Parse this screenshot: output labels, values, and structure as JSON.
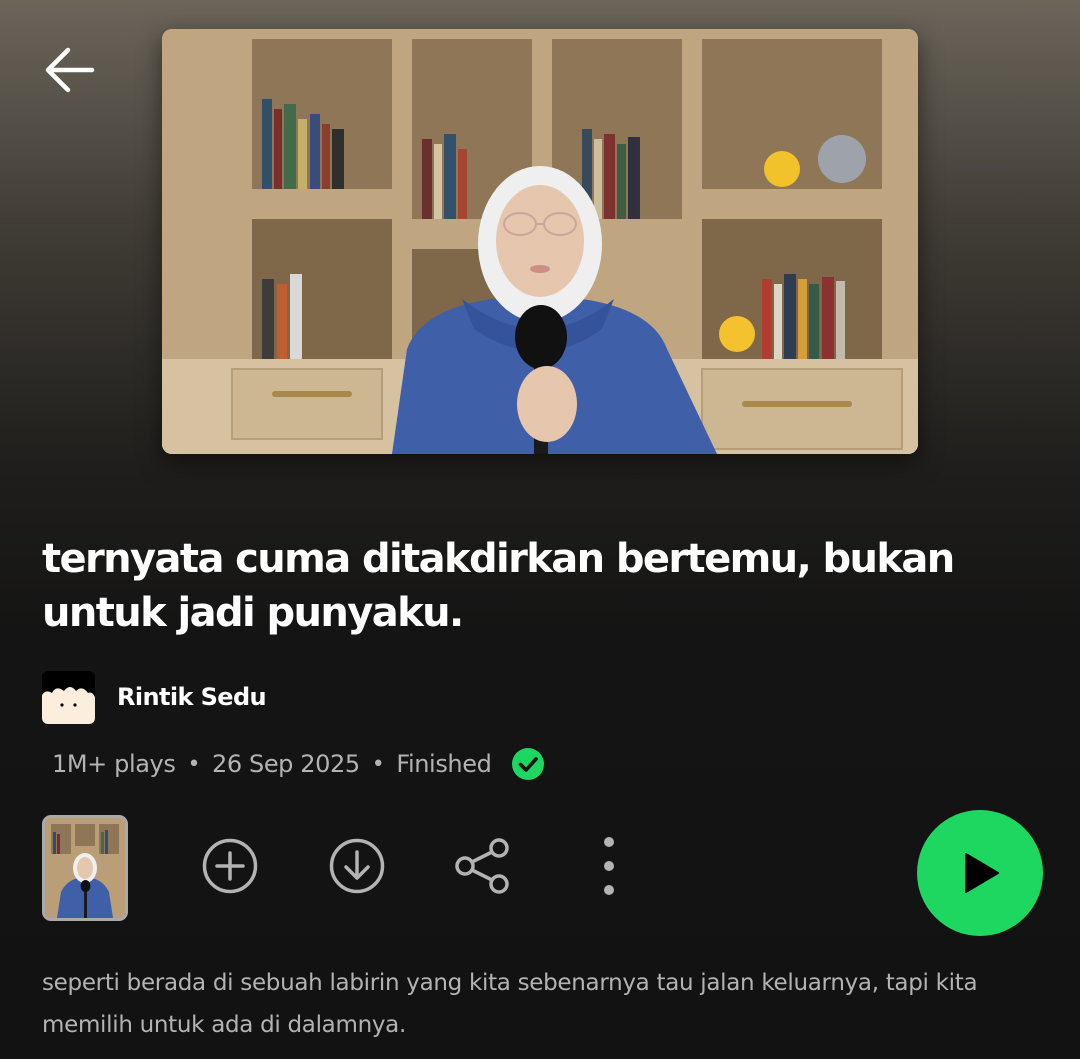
{
  "nav": {
    "back_icon": "arrow-left-icon"
  },
  "episode": {
    "title": "ternyata cuma ditakdirkan bertemu, bukan untuk jadi punyaku.",
    "show_name": "Rintik Sedu",
    "plays": "1M+ plays",
    "date": "26 Sep 2025",
    "status": "Finished",
    "separator": "•",
    "description": "seperti berada di sebuah labirin yang kita sebenarnya tau jalan keluarnya, tapi kita memilih untuk ada di dalamnya."
  },
  "actions": {
    "add_icon": "plus-circle-icon",
    "download_icon": "download-circle-icon",
    "share_icon": "share-icon",
    "more_icon": "more-vertical-icon",
    "play_icon": "play-icon"
  },
  "colors": {
    "accent": "#1ed760",
    "text_primary": "#ffffff",
    "text_secondary": "#b3b3b3",
    "background": "#121212"
  }
}
